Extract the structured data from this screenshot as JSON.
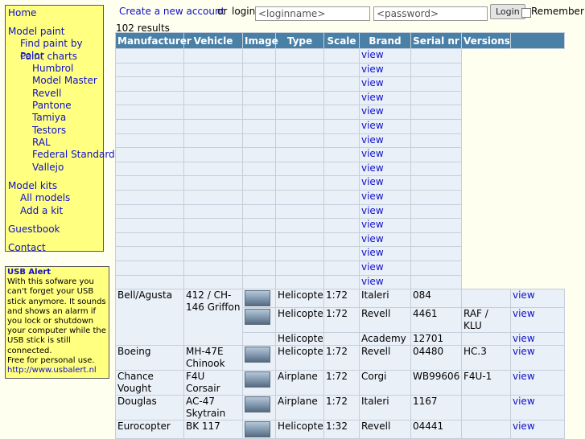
{
  "nav": {
    "home": "Home",
    "model_paint": "Model paint",
    "find_paint_by_color": "Find paint by color",
    "paint_charts": "Paint charts",
    "brands": [
      "Humbrol",
      "Model Master",
      "Revell",
      "Pantone",
      "Tamiya",
      "Testors",
      "RAL",
      "Federal Standard",
      "Vallejo"
    ],
    "model_kits": "Model kits",
    "all_models": "All models",
    "add_a_kit": "Add a kit",
    "guestbook": "Guestbook",
    "contact": "Contact"
  },
  "alert": {
    "title": "USB Alert",
    "body": "With this sofware you can't forget your USB stick anymore. It sounds and shows an alarm if you lock or shutdown your computer while the USB stick is still connected.",
    "free": "Free for personal use.",
    "link": "http://www.usbalert.nl"
  },
  "login": {
    "create_account": "Create a new account",
    "or": "or",
    "login_label": "login:",
    "username_value": "<loginname>",
    "password_value": "<password>",
    "button": "Login",
    "remember": "Remember"
  },
  "results": "102 results",
  "table": {
    "headers": [
      "Manufacturer",
      "Vehicle",
      "Image",
      "Type",
      "Scale",
      "Brand",
      "Serial nr",
      "Versions",
      ""
    ],
    "empty_rows": [
      "view",
      "view",
      "view",
      "view",
      "view",
      "view",
      "view",
      "view",
      "view",
      "view",
      "view",
      "view",
      "view",
      "view",
      "view",
      "view",
      "view"
    ],
    "rows": [
      {
        "manufacturer": "Bell/Agusta",
        "vehicle": "412 / CH-146 Griffon",
        "type": "Helicopter",
        "scale": "1:72",
        "brand": "Italeri",
        "serial": "084",
        "versions": "",
        "link": "view",
        "image": true
      },
      {
        "manufacturer": "",
        "vehicle": "",
        "type": "Helicopter",
        "scale": "1:72",
        "brand": "Revell",
        "serial": "4461",
        "versions": "RAF / KLU",
        "link": "view",
        "image": true
      },
      {
        "manufacturer": "",
        "vehicle": "",
        "type": "Helicopter",
        "scale": "",
        "brand": "Academy",
        "serial": "12701",
        "versions": "",
        "link": "view",
        "image": false
      },
      {
        "manufacturer": "Boeing",
        "vehicle": "MH-47E Chinook",
        "type": "Helicopter",
        "scale": "1:72",
        "brand": "Revell",
        "serial": "04480",
        "versions": "HC.3",
        "link": "view",
        "image": true
      },
      {
        "manufacturer": "Chance Vought",
        "vehicle": "F4U Corsair",
        "type": "Airplane",
        "scale": "1:72",
        "brand": "Corgi",
        "serial": "WB99606",
        "versions": "F4U-1",
        "link": "view",
        "image": true
      },
      {
        "manufacturer": "Douglas",
        "vehicle": "AC-47 Skytrain",
        "type": "Airplane",
        "scale": "1:72",
        "brand": "Italeri",
        "serial": "1167",
        "versions": "",
        "link": "view",
        "image": true
      },
      {
        "manufacturer": "Eurocopter",
        "vehicle": "BK 117",
        "type": "Helicopter",
        "scale": "1:32",
        "brand": "Revell",
        "serial": "04441",
        "versions": "",
        "link": "view",
        "image": true
      }
    ]
  }
}
